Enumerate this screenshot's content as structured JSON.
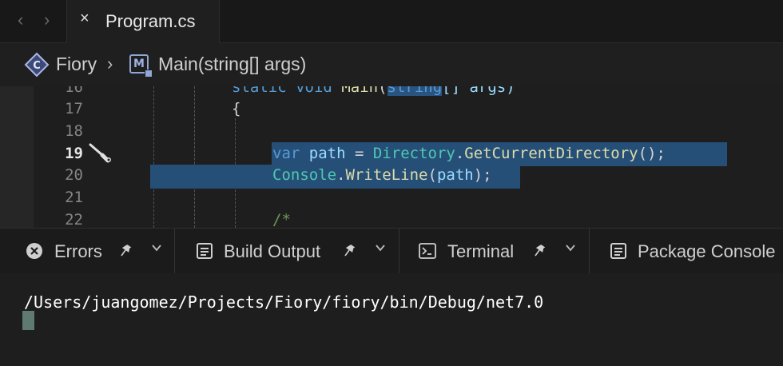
{
  "tabbar": {
    "back_icon": "‹",
    "forward_icon": "›",
    "active_tab": {
      "close_icon": "×",
      "label": "Program.cs"
    }
  },
  "breadcrumb": {
    "class_icon_letter": "C",
    "class_name": "Fiory",
    "separator": "›",
    "method_icon_letter": "M",
    "method_name": "Main(string[] args)"
  },
  "editor": {
    "line_numbers": [
      "16",
      "17",
      "18",
      "19",
      "20",
      "21",
      "22"
    ],
    "active_line": "19",
    "line16": {
      "static": "static",
      "void": "void",
      "main": "Main",
      "paren": "(",
      "string": "string",
      "rest": "[] args)"
    },
    "line17": {
      "brace": "{"
    },
    "line19": {
      "var": "var",
      "path": "path",
      "eq": " = ",
      "directory": "Directory",
      "dot": ".",
      "method": "GetCurrentDirectory",
      "end": "();"
    },
    "line20": {
      "console": "Console",
      "dot": ".",
      "method": "WriteLine",
      "open": "(",
      "arg": "path",
      "close": ");"
    },
    "line22": {
      "comment": "/*"
    },
    "colors": {
      "keyword": "#569cd6",
      "type": "#4ec9b0",
      "method": "#dcdcaa",
      "param": "#9cdcfe",
      "comment": "#6a9955",
      "selection": "#264f78"
    }
  },
  "panel": {
    "tabs": [
      {
        "label": "Errors",
        "icon": "error-circle-icon",
        "pinned": true
      },
      {
        "label": "Build Output",
        "icon": "output-icon",
        "pinned": true
      },
      {
        "label": "Terminal",
        "icon": "terminal-icon",
        "pinned": true
      },
      {
        "label": "Package Console",
        "icon": "console-icon",
        "pinned": false
      }
    ]
  },
  "terminal": {
    "output": "/Users/juangomez/Projects/Fiory/fiory/bin/Debug/net7.0"
  }
}
